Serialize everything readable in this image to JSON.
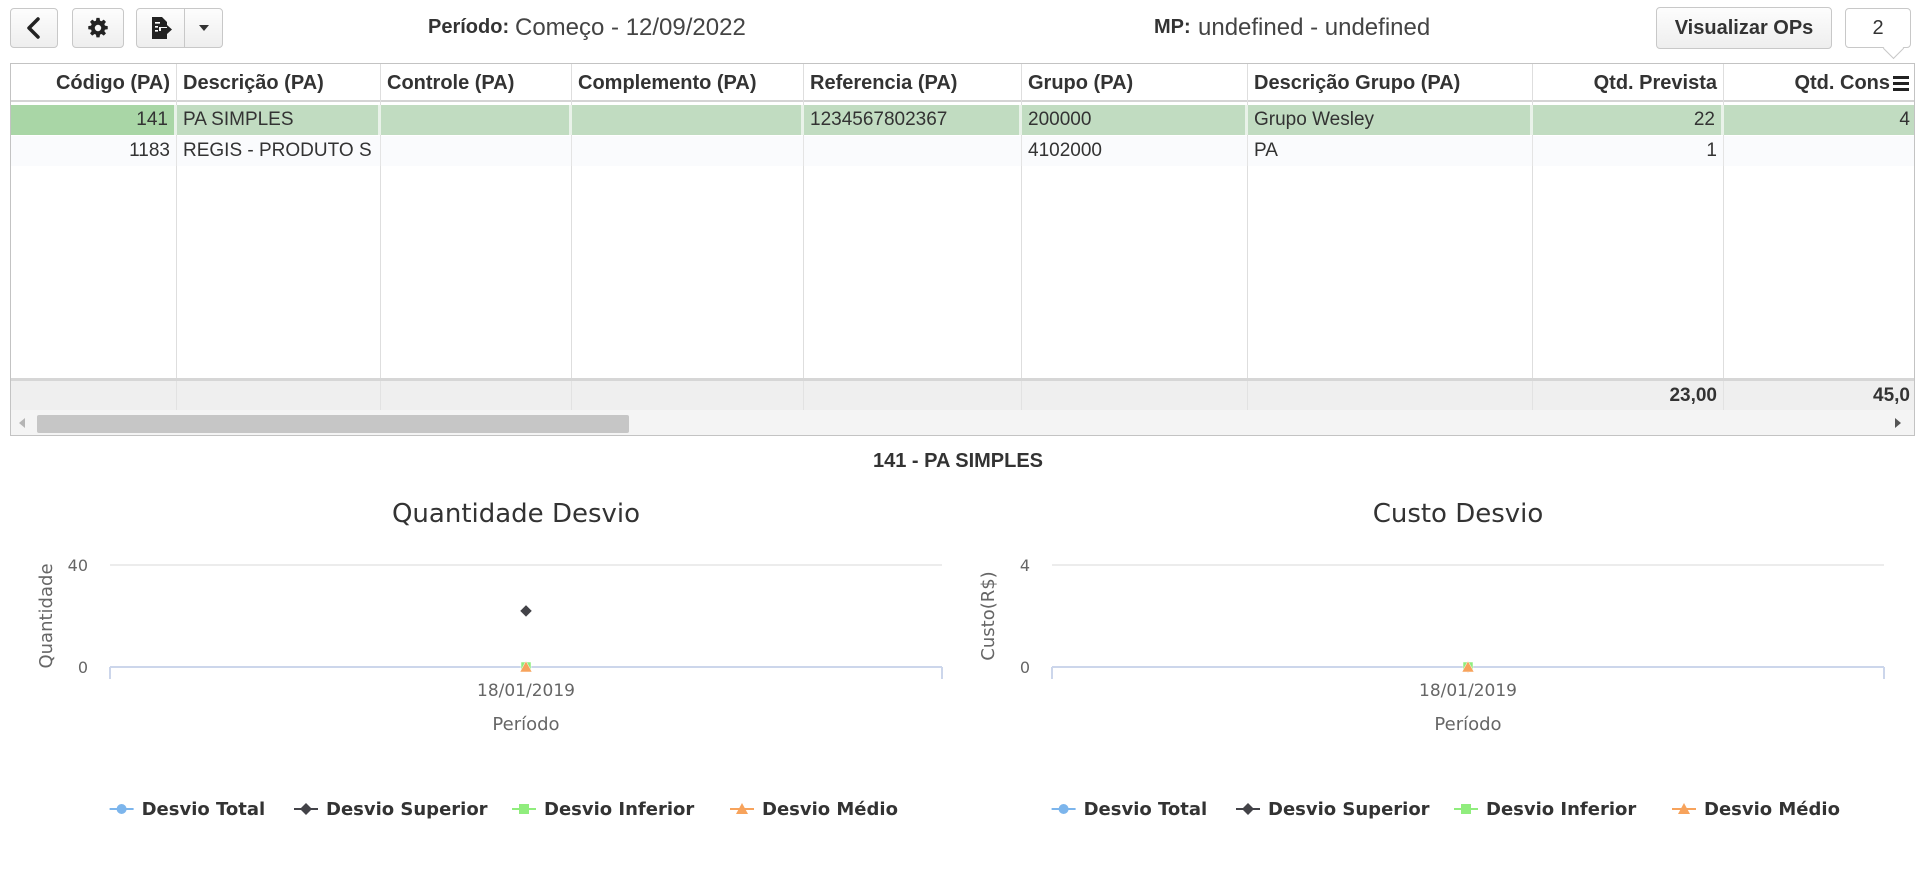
{
  "toolbar": {
    "back_icon": "chevron-left-icon",
    "settings_icon": "gear-icon",
    "export_icon": "file-export-icon",
    "dropdown_icon": "caret-down-icon",
    "periodo_label": "Período:",
    "periodo_value": "Começo - 12/09/2022",
    "mp_label": "MP:",
    "mp_value": "undefined - undefined",
    "visualizar_button": "Visualizar OPs",
    "count": "2"
  },
  "grid": {
    "columns": [
      "Código (PA)",
      "Descrição (PA)",
      "Controle (PA)",
      "Complemento (PA)",
      "Referencia (PA)",
      "Grupo (PA)",
      "Descrição Grupo (PA)",
      "Qtd. Prevista",
      "Qtd. Consur"
    ],
    "rows": [
      {
        "codigo": "141",
        "descricao": "PA SIMPLES",
        "controle": "",
        "complemento": "",
        "referencia": "1234567802367",
        "grupo": "200000",
        "descricao_grupo": "Grupo Wesley",
        "qtd_prevista": "22",
        "qtd_consumida": "4",
        "selected": true
      },
      {
        "codigo": "1183",
        "descricao": "REGIS - PRODUTO S",
        "controle": "",
        "complemento": "",
        "referencia": "",
        "grupo": "4102000",
        "descricao_grupo": "PA",
        "qtd_prevista": "1",
        "qtd_consumida": "",
        "selected": false
      }
    ],
    "summary": {
      "qtd_prevista": "23,00",
      "qtd_consumida": "45,0"
    }
  },
  "selected_title": "141 - PA SIMPLES",
  "chart_data": [
    {
      "type": "line",
      "title": "Quantidade Desvio",
      "xlabel": "Período",
      "ylabel": "Quantidade",
      "categories": [
        "18/01/2019"
      ],
      "yticks": [
        0,
        40
      ],
      "ylim": [
        0,
        40
      ],
      "grid": true,
      "legend_placement": "bottom",
      "series": [
        {
          "name": "Desvio Total",
          "values": [
            0
          ],
          "color": "#7cb5ec",
          "marker": "circle"
        },
        {
          "name": "Desvio Superior",
          "values": [
            22
          ],
          "color": "#434348",
          "marker": "diamond"
        },
        {
          "name": "Desvio Inferior",
          "values": [
            0
          ],
          "color": "#90ed7d",
          "marker": "square"
        },
        {
          "name": "Desvio Médio",
          "values": [
            0
          ],
          "color": "#f7a35c",
          "marker": "triangle"
        }
      ]
    },
    {
      "type": "line",
      "title": "Custo Desvio",
      "xlabel": "Período",
      "ylabel": "Custo(R$)",
      "categories": [
        "18/01/2019"
      ],
      "yticks": [
        0,
        4
      ],
      "ylim": [
        0,
        4
      ],
      "grid": true,
      "legend_placement": "bottom",
      "series": [
        {
          "name": "Desvio Total",
          "values": [
            0
          ],
          "color": "#7cb5ec",
          "marker": "circle"
        },
        {
          "name": "Desvio Superior",
          "values": [
            0
          ],
          "color": "#434348",
          "marker": "diamond"
        },
        {
          "name": "Desvio Inferior",
          "values": [
            0
          ],
          "color": "#90ed7d",
          "marker": "square"
        },
        {
          "name": "Desvio Médio",
          "values": [
            0
          ],
          "color": "#f7a35c",
          "marker": "triangle"
        }
      ]
    }
  ]
}
